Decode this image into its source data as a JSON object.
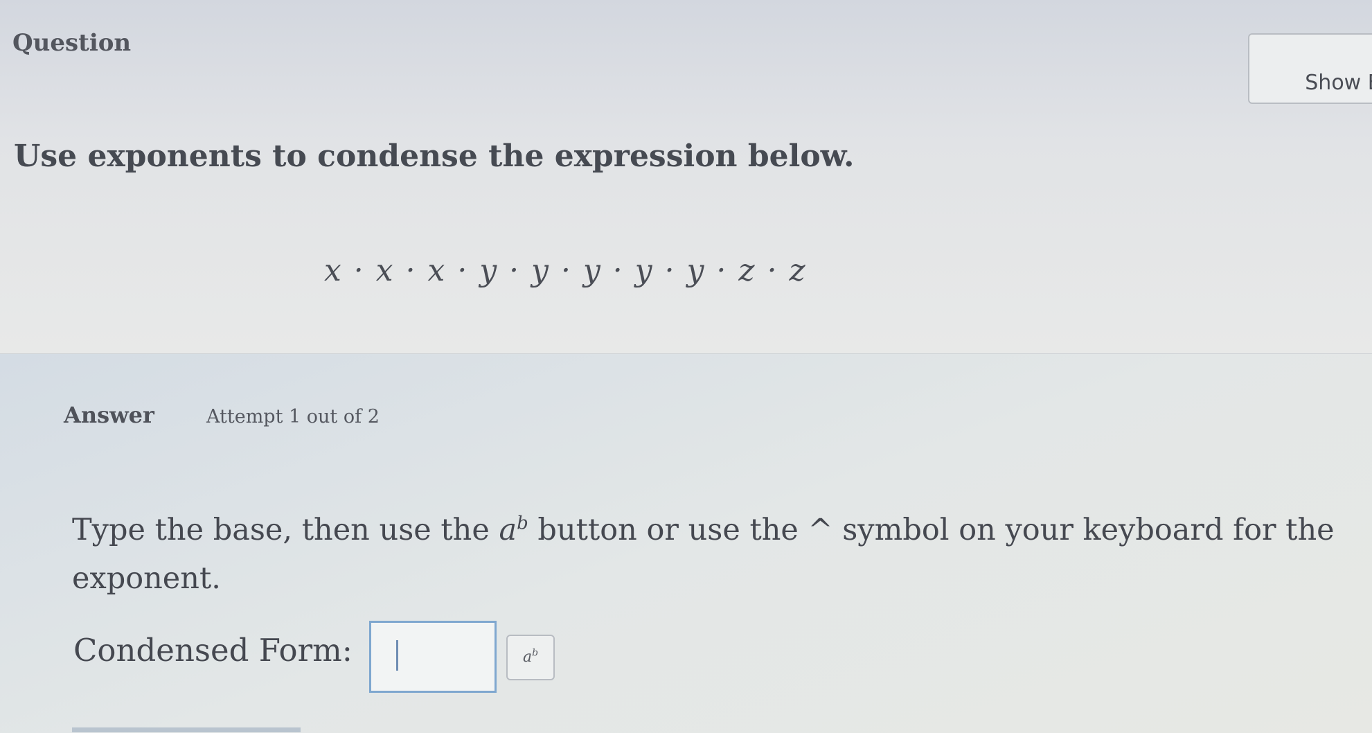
{
  "question": {
    "label": "Question",
    "show_button_label": "Show E",
    "prompt": "Use exponents to condense the expression below.",
    "expression": "x · x · x · y · y · y · y · y · z · z"
  },
  "answer": {
    "label": "Answer",
    "attempt": "Attempt 1 out of 2",
    "instruction_before": "Type the base, then use the ",
    "instruction_base": "a",
    "instruction_sup": "b",
    "instruction_after": " button or use the ^ symbol on your keyboard for the exponent.",
    "condensed_label": "Condensed Form:",
    "input_value": "",
    "exponent_button": {
      "base": "a",
      "sup": "b"
    }
  }
}
